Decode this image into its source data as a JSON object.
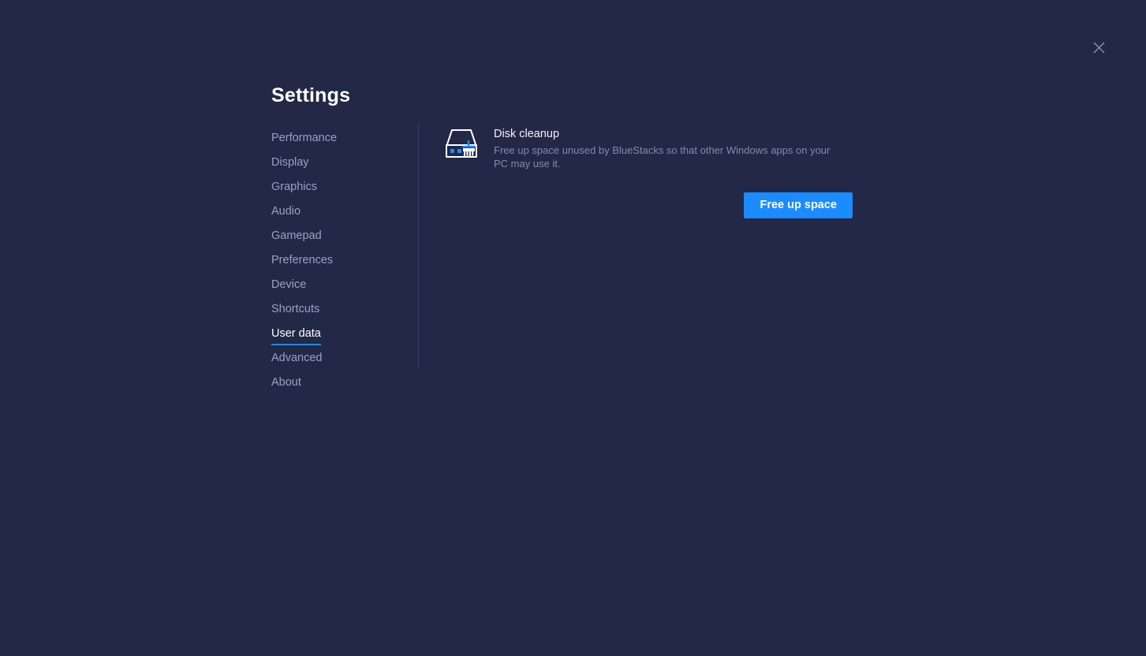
{
  "window": {
    "title": "Settings",
    "close_icon": "close-icon"
  },
  "sidebar": {
    "items": [
      {
        "label": "Performance",
        "active": false
      },
      {
        "label": "Display",
        "active": false
      },
      {
        "label": "Graphics",
        "active": false
      },
      {
        "label": "Audio",
        "active": false
      },
      {
        "label": "Gamepad",
        "active": false
      },
      {
        "label": "Preferences",
        "active": false
      },
      {
        "label": "Device",
        "active": false
      },
      {
        "label": "Shortcuts",
        "active": false
      },
      {
        "label": "User data",
        "active": true
      },
      {
        "label": "Advanced",
        "active": false
      },
      {
        "label": "About",
        "active": false
      }
    ]
  },
  "main": {
    "section": {
      "icon": "disk-cleanup-icon",
      "title": "Disk cleanup",
      "description": "Free up space unused by BlueStacks so that other Windows apps on your PC may use it.",
      "action_label": "Free up space"
    }
  },
  "colors": {
    "background": "#222845",
    "accent": "#1a8cff",
    "text_primary": "#ffffff",
    "text_muted": "#9aa1c4",
    "text_secondary": "#838ab0",
    "divider": "#3a4064"
  }
}
